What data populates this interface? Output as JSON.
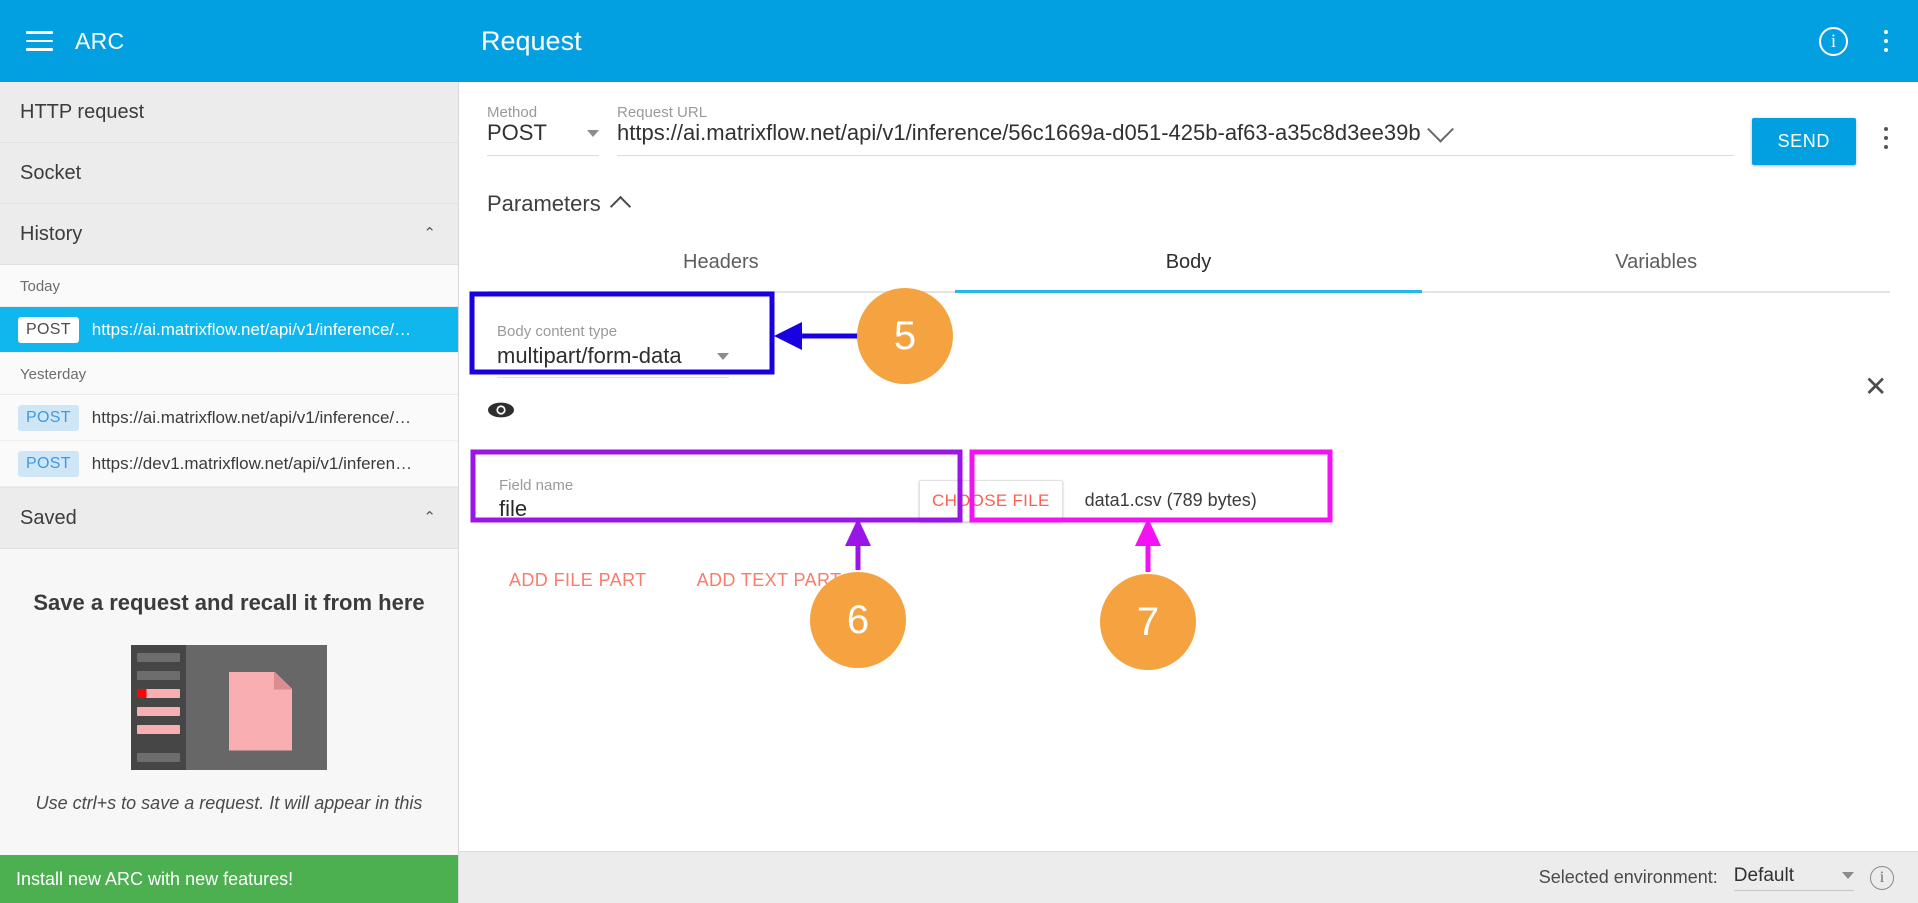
{
  "topbar": {
    "brand": "ARC",
    "title": "Request",
    "menu_icon": "hamburger-icon",
    "info_icon": "info-icon",
    "overflow_icon": "kebab-menu-icon",
    "background": "#03A0E1"
  },
  "sidebar": {
    "nav": [
      {
        "label": "HTTP request"
      },
      {
        "label": "Socket"
      },
      {
        "label": "History",
        "chevron": "⌃"
      },
      {
        "label": "Saved",
        "chevron": "⌃"
      }
    ],
    "history": {
      "groups": [
        {
          "label": "Today",
          "items": [
            {
              "method": "POST",
              "url": "https://ai.matrixflow.net/api/v1/inference/…",
              "selected": true
            }
          ]
        },
        {
          "label": "Yesterday",
          "items": [
            {
              "method": "POST",
              "url": "https://ai.matrixflow.net/api/v1/inference/…",
              "selected": false
            },
            {
              "method": "POST",
              "url": "https://dev1.matrixflow.net/api/v1/inferen…",
              "selected": false
            }
          ]
        }
      ]
    },
    "saved_empty": {
      "heading": "Save a request and recall it from here",
      "hint": "Use ctrl+s to save a request. It will appear in this"
    },
    "install_banner": "Install new ARC with new features!"
  },
  "request": {
    "method_label": "Method",
    "method_value": "POST",
    "url_label": "Request URL",
    "url_value": "https://ai.matrixflow.net/api/v1/inference/56c1669a-d051-425b-af63-a35c8d3ee39b",
    "send_label": "SEND",
    "parameters_label": "Parameters"
  },
  "tabs": [
    {
      "label": "Headers",
      "active": false
    },
    {
      "label": "Body",
      "active": true
    },
    {
      "label": "Variables",
      "active": false
    }
  ],
  "body_pane": {
    "content_type_label": "Body content type",
    "content_type_value": "multipart/form-data",
    "preview_icon": "eye-icon",
    "field_name_label": "Field name",
    "field_name_value": "file",
    "choose_file_label": "CHOOSE FILE",
    "file_info": "data1.csv (789 bytes)",
    "delete_part_icon": "close-icon",
    "delete_part_glyph": "✕",
    "add_file_part_label": "ADD FILE PART",
    "add_text_part_label": "ADD TEXT PART"
  },
  "footer": {
    "env_label": "Selected environment:",
    "env_value": "Default",
    "info_icon": "info-icon"
  },
  "annotations": {
    "colors": {
      "badge": "#F5A341",
      "box_blue": "#1800E0",
      "box_purple": "#9915E8",
      "box_magenta": "#F312F3"
    },
    "callouts": [
      {
        "number": "5",
        "color": "#1800E0"
      },
      {
        "number": "6",
        "color": "#9915E8"
      },
      {
        "number": "7",
        "color": "#F312F3"
      }
    ]
  }
}
